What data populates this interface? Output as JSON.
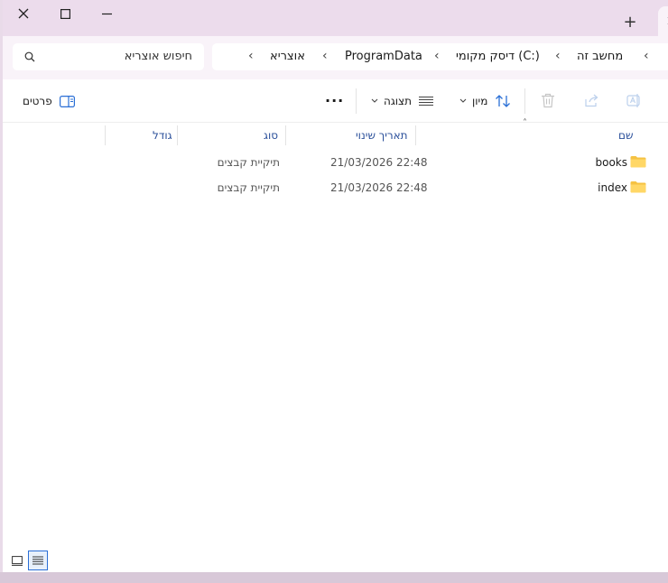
{
  "window": {
    "minimize_icon": "minimize-icon",
    "maximize_icon": "maximize-icon",
    "close_icon": "close-icon",
    "new_tab_label": "+",
    "tab_close_label": "x"
  },
  "search": {
    "placeholder": "חיפוש אוצריא"
  },
  "breadcrumb": {
    "items": [
      "מחשב זה",
      "דיסק מקומי (C:)",
      "ProgramData",
      "אוצריא"
    ]
  },
  "toolbar": {
    "details_label": "פרטים",
    "view_label": "תצוגה",
    "sort_label": "מיון",
    "more_label": "···"
  },
  "columns": {
    "name": "שם",
    "date": "תאריך שינוי",
    "type": "סוג",
    "size": "גודל"
  },
  "files": [
    {
      "name": "books",
      "date": "21/03/2026 22:48",
      "type": "תיקיית קבצים"
    },
    {
      "name": "index",
      "date": "21/03/2026 22:48",
      "type": "תיקיית קבצים"
    }
  ],
  "colors": {
    "accent": "#2a6fd6",
    "folder": "#f5c242",
    "header_text": "#2a4f9a"
  }
}
